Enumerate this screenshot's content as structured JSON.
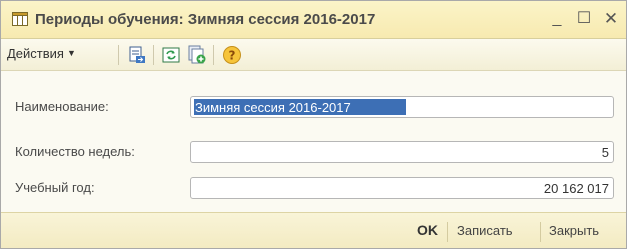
{
  "window": {
    "title": "Периоды обучения: Зимняя сессия 2016-2017",
    "minimize_glyph": "_",
    "maximize_glyph": "☐",
    "close_glyph": "✕"
  },
  "toolbar": {
    "actions_label": "Действия",
    "icons": [
      "post-document-icon",
      "refresh-icon",
      "copy-add-icon",
      "help-icon"
    ]
  },
  "form": {
    "name_label": "Наименование:",
    "name_value": "Зимняя сессия 2016-2017",
    "weeks_label": "Количество недель:",
    "weeks_value": "5",
    "year_label": "Учебный год:",
    "year_value": "20 162 017"
  },
  "footer": {
    "ok_label": "OK",
    "save_label": "Записать",
    "close_label": "Закрыть"
  },
  "colors": {
    "titlebar": "#f7eab0",
    "selection": "#3d6fb5",
    "background": "#fbfaf2"
  }
}
